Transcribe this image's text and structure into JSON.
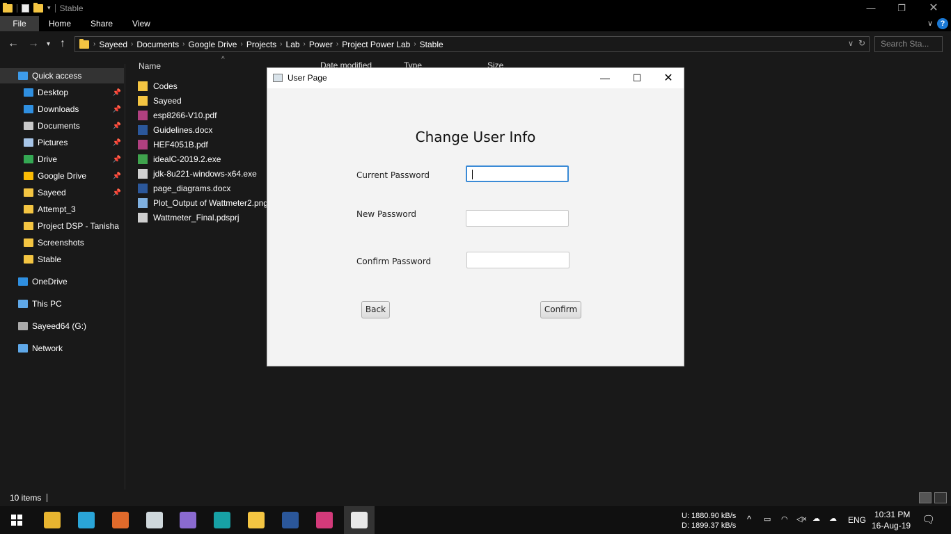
{
  "window": {
    "title": "Stable"
  },
  "ribbon": {
    "tabs": [
      "File",
      "Home",
      "Share",
      "View"
    ]
  },
  "address": {
    "crumbs": [
      "Sayeed",
      "Documents",
      "Google Drive",
      "Projects",
      "Lab",
      "Power",
      "Project Power Lab",
      "Stable"
    ]
  },
  "search": {
    "placeholder": "Search Sta..."
  },
  "sidebar": {
    "items": [
      {
        "label": "Quick access",
        "icon": "star-icon",
        "color": "#3d9be9",
        "pinned": false
      },
      {
        "label": "Desktop",
        "icon": "desktop-icon",
        "color": "#2f8fe0",
        "pinned": true
      },
      {
        "label": "Downloads",
        "icon": "download-arrow-icon",
        "color": "#2f8fe0",
        "pinned": true
      },
      {
        "label": "Documents",
        "icon": "documents-icon",
        "color": "#c9c9c9",
        "pinned": true
      },
      {
        "label": "Pictures",
        "icon": "pictures-icon",
        "color": "#a7c5e8",
        "pinned": true
      },
      {
        "label": "Drive",
        "icon": "google-drive-icon",
        "color": "#34a853",
        "pinned": true
      },
      {
        "label": "Google Drive",
        "icon": "google-drive-icon",
        "color": "#fbbc05",
        "pinned": true
      },
      {
        "label": "Sayeed",
        "icon": "folder-icon",
        "color": "#f4c542",
        "pinned": true
      },
      {
        "label": "Attempt_3",
        "icon": "folder-icon",
        "color": "#f4c542",
        "pinned": false
      },
      {
        "label": "Project DSP - Tanisha",
        "icon": "folder-icon",
        "color": "#f4c542",
        "pinned": false
      },
      {
        "label": "Screenshots",
        "icon": "folder-icon",
        "color": "#f4c542",
        "pinned": false
      },
      {
        "label": "Stable",
        "icon": "folder-icon",
        "color": "#f4c542",
        "pinned": false
      },
      {
        "label": "OneDrive",
        "icon": "cloud-icon",
        "color": "#2f8fe0",
        "pinned": false
      },
      {
        "label": "This PC",
        "icon": "computer-icon",
        "color": "#5fa8e8",
        "pinned": false
      },
      {
        "label": "Sayeed64 (G:)",
        "icon": "drive-icon",
        "color": "#aaaaaa",
        "pinned": false
      },
      {
        "label": "Network",
        "icon": "network-icon",
        "color": "#5fa8e8",
        "pinned": false
      }
    ]
  },
  "columns": [
    "Name",
    "Date modified",
    "Type",
    "Size"
  ],
  "files": [
    {
      "name": "Codes",
      "icon": "folder-icon",
      "color": "#f4c542"
    },
    {
      "name": "Sayeed",
      "icon": "folder-icon",
      "color": "#f4c542"
    },
    {
      "name": "esp8266-V10.pdf",
      "icon": "pdf-icon",
      "color": "#b04080"
    },
    {
      "name": "Guidelines.docx",
      "icon": "word-icon",
      "color": "#2b579a"
    },
    {
      "name": "HEF4051B.pdf",
      "icon": "pdf-icon",
      "color": "#b04080"
    },
    {
      "name": "idealC-2019.2.exe",
      "icon": "intellij-icon",
      "color": "#3fa34d"
    },
    {
      "name": "jdk-8u221-windows-x64.exe",
      "icon": "java-installer-icon",
      "color": "#d0d0d0"
    },
    {
      "name": "page_diagrams.docx",
      "icon": "word-icon",
      "color": "#2b579a"
    },
    {
      "name": "Plot_Output of Wattmeter2.png",
      "icon": "image-icon",
      "color": "#7fb0e0"
    },
    {
      "name": "Wattmeter_Final.pdsprj",
      "icon": "proteus-icon",
      "color": "#cfcfcf"
    }
  ],
  "status": {
    "text": "10 items"
  },
  "dialog": {
    "title": "User Page",
    "heading": "Change User Info",
    "current_label": "Current Password",
    "new_label": "New Password",
    "confirm_label": "Confirm Password",
    "back_button": "Back",
    "confirm_button": "Confirm"
  },
  "tray": {
    "upload": "U:   1880.90 kB/s",
    "download": "D:   1899.37 kB/s",
    "lang": "ENG",
    "time": "10:31 PM",
    "date": "16-Aug-19"
  },
  "taskbar": {
    "apps": [
      {
        "name": "chrome-icon",
        "color": "#e8b530"
      },
      {
        "name": "mail-app-icon",
        "color": "#2aa5d8"
      },
      {
        "name": "matlab-icon",
        "color": "#e06a2b"
      },
      {
        "name": "proteus-icon",
        "color": "#cfd8dc"
      },
      {
        "name": "visual-studio-icon",
        "color": "#8a6ad0"
      },
      {
        "name": "arduino-icon",
        "color": "#17a1a5"
      },
      {
        "name": "file-explorer-icon",
        "color": "#f4c542"
      },
      {
        "name": "word-icon",
        "color": "#2b579a"
      },
      {
        "name": "intellij-icon",
        "color": "#d33a7a"
      },
      {
        "name": "java-icon",
        "color": "#e8e8e8"
      }
    ]
  }
}
